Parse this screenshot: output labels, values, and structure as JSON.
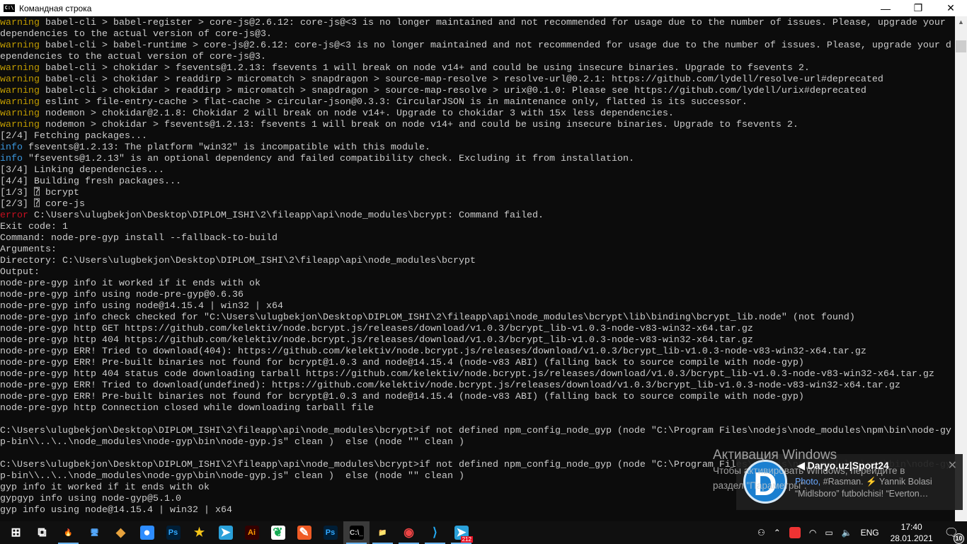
{
  "window": {
    "title": "Командная строка",
    "icon": "cmd-icon",
    "minimize": "—",
    "maximize": "❐",
    "close": "✕"
  },
  "colors": {
    "warning": "#c19c00",
    "info": "#3a96dd",
    "error": "#c50f1f",
    "text": "#cccccc",
    "bg": "#0c0c0c"
  },
  "lines": [
    {
      "p": "warning",
      "c": "warning",
      "t": " babel-cli > babel-register > core-js@2.6.12: core-js@<3 is no longer maintained and not recommended for usage due to the number of issues. Please, upgrade your"
    },
    {
      "p": "",
      "c": "",
      "t": "dependencies to the actual version of core-js@3."
    },
    {
      "p": "warning",
      "c": "warning",
      "t": " babel-cli > babel-runtime > core-js@2.6.12: core-js@<3 is no longer maintained and not recommended for usage due to the number of issues. Please, upgrade your d"
    },
    {
      "p": "",
      "c": "",
      "t": "ependencies to the actual version of core-js@3."
    },
    {
      "p": "warning",
      "c": "warning",
      "t": " babel-cli > chokidar > fsevents@1.2.13: fsevents 1 will break on node v14+ and could be using insecure binaries. Upgrade to fsevents 2."
    },
    {
      "p": "warning",
      "c": "warning",
      "t": " babel-cli > chokidar > readdirp > micromatch > snapdragon > source-map-resolve > resolve-url@0.2.1: https://github.com/lydell/resolve-url#deprecated"
    },
    {
      "p": "warning",
      "c": "warning",
      "t": " babel-cli > chokidar > readdirp > micromatch > snapdragon > source-map-resolve > urix@0.1.0: Please see https://github.com/lydell/urix#deprecated"
    },
    {
      "p": "warning",
      "c": "warning",
      "t": " eslint > file-entry-cache > flat-cache > circular-json@0.3.3: CircularJSON is in maintenance only, flatted is its successor."
    },
    {
      "p": "warning",
      "c": "warning",
      "t": " nodemon > chokidar@2.1.8: Chokidar 2 will break on node v14+. Upgrade to chokidar 3 with 15x less dependencies."
    },
    {
      "p": "warning",
      "c": "warning",
      "t": " nodemon > chokidar > fsevents@1.2.13: fsevents 1 will break on node v14+ and could be using insecure binaries. Upgrade to fsevents 2."
    },
    {
      "p": "",
      "c": "",
      "t": "[2/4] Fetching packages..."
    },
    {
      "p": "info",
      "c": "info",
      "t": " fsevents@1.2.13: The platform \"win32\" is incompatible with this module."
    },
    {
      "p": "info",
      "c": "info",
      "t": " \"fsevents@1.2.13\" is an optional dependency and failed compatibility check. Excluding it from installation."
    },
    {
      "p": "",
      "c": "",
      "t": "[3/4] Linking dependencies..."
    },
    {
      "p": "",
      "c": "",
      "t": "[4/4] Building fresh packages..."
    },
    {
      "p": "",
      "c": "",
      "t": "[1/3] ⍰ bcrypt"
    },
    {
      "p": "",
      "c": "",
      "t": "[2/3] ⍰ core-js"
    },
    {
      "p": "error",
      "c": "error",
      "t": " C:\\Users\\ulugbekjon\\Desktop\\DIPLOM_ISHI\\2\\fileapp\\api\\node_modules\\bcrypt: Command failed."
    },
    {
      "p": "",
      "c": "",
      "t": "Exit code: 1"
    },
    {
      "p": "",
      "c": "",
      "t": "Command: node-pre-gyp install --fallback-to-build"
    },
    {
      "p": "",
      "c": "",
      "t": "Arguments:"
    },
    {
      "p": "",
      "c": "",
      "t": "Directory: C:\\Users\\ulugbekjon\\Desktop\\DIPLOM_ISHI\\2\\fileapp\\api\\node_modules\\bcrypt"
    },
    {
      "p": "",
      "c": "",
      "t": "Output:"
    },
    {
      "p": "",
      "c": "",
      "t": "node-pre-gyp info it worked if it ends with ok"
    },
    {
      "p": "",
      "c": "",
      "t": "node-pre-gyp info using node-pre-gyp@0.6.36"
    },
    {
      "p": "",
      "c": "",
      "t": "node-pre-gyp info using node@14.15.4 | win32 | x64"
    },
    {
      "p": "",
      "c": "",
      "t": "node-pre-gyp info check checked for \"C:\\Users\\ulugbekjon\\Desktop\\DIPLOM_ISHI\\2\\fileapp\\api\\node_modules\\bcrypt\\lib\\binding\\bcrypt_lib.node\" (not found)"
    },
    {
      "p": "",
      "c": "",
      "t": "node-pre-gyp http GET https://github.com/kelektiv/node.bcrypt.js/releases/download/v1.0.3/bcrypt_lib-v1.0.3-node-v83-win32-x64.tar.gz"
    },
    {
      "p": "",
      "c": "",
      "t": "node-pre-gyp http 404 https://github.com/kelektiv/node.bcrypt.js/releases/download/v1.0.3/bcrypt_lib-v1.0.3-node-v83-win32-x64.tar.gz"
    },
    {
      "p": "",
      "c": "",
      "t": "node-pre-gyp ERR! Tried to download(404): https://github.com/kelektiv/node.bcrypt.js/releases/download/v1.0.3/bcrypt_lib-v1.0.3-node-v83-win32-x64.tar.gz"
    },
    {
      "p": "",
      "c": "",
      "t": "node-pre-gyp ERR! Pre-built binaries not found for bcrypt@1.0.3 and node@14.15.4 (node-v83 ABI) (falling back to source compile with node-gyp)"
    },
    {
      "p": "",
      "c": "",
      "t": "node-pre-gyp http 404 status code downloading tarball https://github.com/kelektiv/node.bcrypt.js/releases/download/v1.0.3/bcrypt_lib-v1.0.3-node-v83-win32-x64.tar.gz"
    },
    {
      "p": "",
      "c": "",
      "t": "node-pre-gyp ERR! Tried to download(undefined): https://github.com/kelektiv/node.bcrypt.js/releases/download/v1.0.3/bcrypt_lib-v1.0.3-node-v83-win32-x64.tar.gz"
    },
    {
      "p": "",
      "c": "",
      "t": "node-pre-gyp ERR! Pre-built binaries not found for bcrypt@1.0.3 and node@14.15.4 (node-v83 ABI) (falling back to source compile with node-gyp)"
    },
    {
      "p": "",
      "c": "",
      "t": "node-pre-gyp http Connection closed while downloading tarball file"
    },
    {
      "p": "",
      "c": "",
      "t": ""
    },
    {
      "p": "",
      "c": "",
      "t": "C:\\Users\\ulugbekjon\\Desktop\\DIPLOM_ISHI\\2\\fileapp\\api\\node_modules\\bcrypt>if not defined npm_config_node_gyp (node \"C:\\Program Files\\nodejs\\node_modules\\npm\\bin\\node-gy"
    },
    {
      "p": "",
      "c": "",
      "t": "p-bin\\\\..\\..\\node_modules\\node-gyp\\bin\\node-gyp.js\" clean )  else (node \"\" clean )"
    },
    {
      "p": "",
      "c": "",
      "t": ""
    },
    {
      "p": "",
      "c": "",
      "t": "C:\\Users\\ulugbekjon\\Desktop\\DIPLOM_ISHI\\2\\fileapp\\api\\node_modules\\bcrypt>if not defined npm_config_node_gyp (node \"C:\\Program Files\\nodejs\\node_modules\\npm\\bin\\node-gy"
    },
    {
      "p": "",
      "c": "",
      "t": "p-bin\\\\..\\..\\node_modules\\node-gyp\\bin\\node-gyp.js\" clean )  else (node \"\" clean )"
    },
    {
      "p": "",
      "c": "",
      "t": "gyp info it worked if it ends with ok"
    },
    {
      "p": "",
      "c": "",
      "t": "gypgyp info using node-gyp@5.1.0"
    },
    {
      "p": "",
      "c": "",
      "t": "gyp info using node@14.15.4 | win32 | x64"
    }
  ],
  "watermark": {
    "title": "Активация Windows",
    "line1": "Чтобы активировать Windows, перейдите в",
    "line2": "раздел \"Параметры\"."
  },
  "notification": {
    "logo": "D",
    "title": "◀ Daryo.uz|Sport24",
    "line1_link": "Photo,",
    "line1": " #Rasman. ⚡ Yannik Bolasi",
    "line2": "“Midlsboro” futbolchisi!  “Everton…",
    "close": "✕"
  },
  "taskbar": {
    "apps": [
      {
        "name": "start",
        "g": "⊞",
        "bg": "transparent",
        "fg": "#fff"
      },
      {
        "name": "task-view",
        "g": "⧉",
        "bg": "transparent",
        "fg": "#fff"
      },
      {
        "name": "firefox-dev",
        "g": "🔥",
        "bg": "transparent",
        "fg": "#f60",
        "open": true
      },
      {
        "name": "this-pc",
        "g": "🖥",
        "bg": "transparent",
        "fg": "#5af"
      },
      {
        "name": "git",
        "g": "◆",
        "bg": "transparent",
        "fg": "#e8a33d"
      },
      {
        "name": "zoom",
        "g": "●",
        "bg": "#2d8cff",
        "fg": "#fff"
      },
      {
        "name": "photoshop",
        "g": "Ps",
        "bg": "#001e36",
        "fg": "#31a8ff"
      },
      {
        "name": "star-app",
        "g": "★",
        "bg": "transparent",
        "fg": "#f5c518"
      },
      {
        "name": "telegram",
        "g": "➤",
        "bg": "#2aa1da",
        "fg": "#fff"
      },
      {
        "name": "illustrator",
        "g": "Ai",
        "bg": "#330000",
        "fg": "#ff9a00"
      },
      {
        "name": "mongodb-compass",
        "g": "❦",
        "bg": "#fff",
        "fg": "#13aa52"
      },
      {
        "name": "postman",
        "g": "✎",
        "bg": "#ef5b25",
        "fg": "#fff"
      },
      {
        "name": "photoshop-2",
        "g": "Ps",
        "bg": "#001e36",
        "fg": "#31a8ff"
      },
      {
        "name": "command-prompt",
        "g": "C:\\_",
        "bg": "#000",
        "fg": "#ccc",
        "active": true,
        "open": true
      },
      {
        "name": "file-explorer",
        "g": "📁",
        "bg": "transparent",
        "fg": "#f8d775",
        "open": true
      },
      {
        "name": "chrome",
        "g": "◉",
        "bg": "transparent",
        "fg": "#e44",
        "open": true
      },
      {
        "name": "vscode",
        "g": "⟩",
        "bg": "transparent",
        "fg": "#23a9f2",
        "open": true
      },
      {
        "name": "telegram-2",
        "g": "➤",
        "bg": "#2aa1da",
        "fg": "#fff",
        "open": true,
        "badge": "212"
      }
    ],
    "tray": {
      "people": "⚇",
      "chevron": "⌃",
      "wifi": "◠",
      "battery": "▭",
      "volume": "🔈",
      "lang": "ENG",
      "time": "17:40",
      "date": "28.01.2021",
      "notifications_count": "10"
    }
  }
}
